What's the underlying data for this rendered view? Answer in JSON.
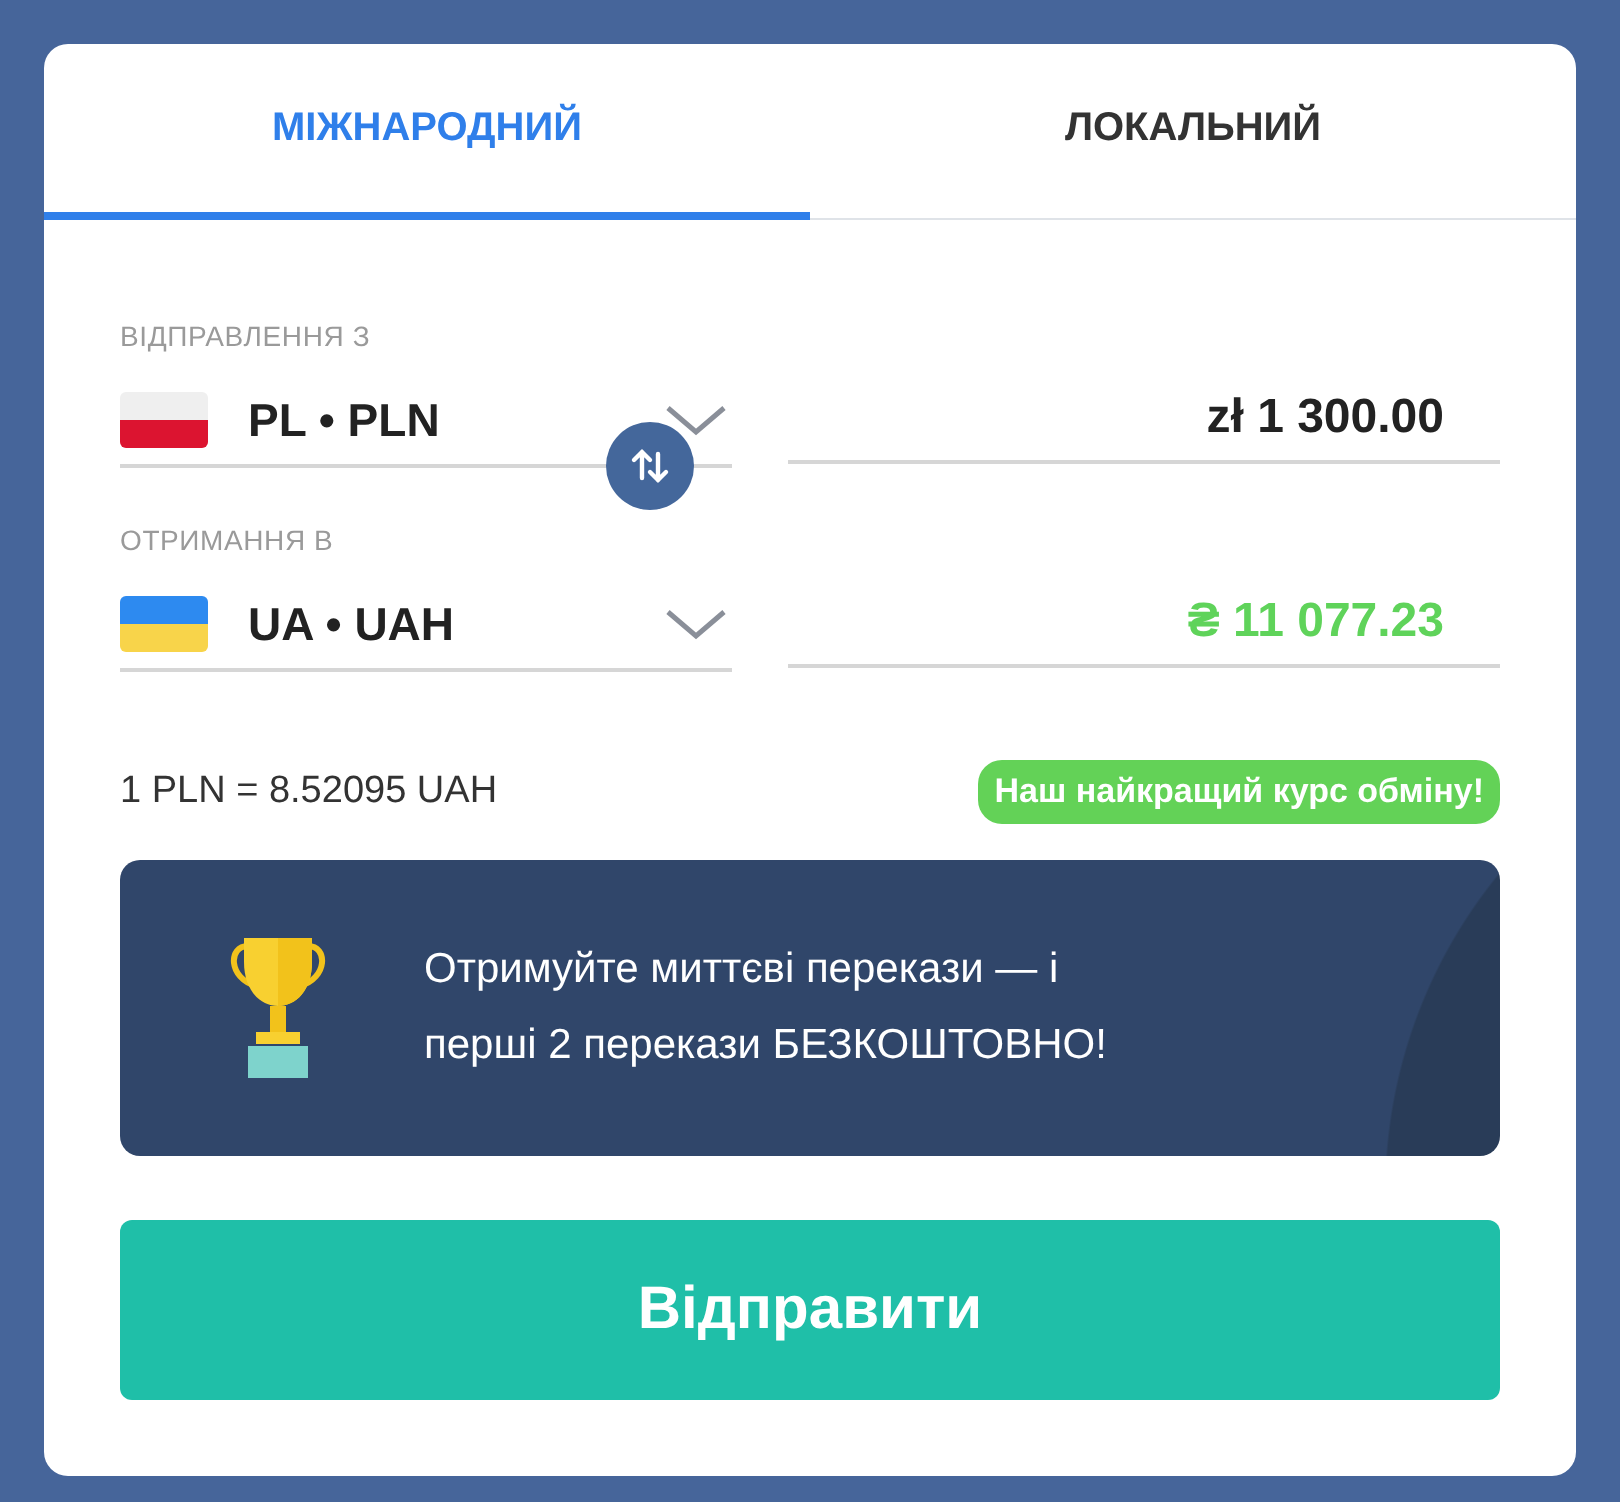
{
  "tabs": [
    {
      "label": "МІЖНАРОДНИЙ",
      "selected": true
    },
    {
      "label": "ЛОКАЛЬНИЙ",
      "selected": false
    }
  ],
  "rows": [
    {
      "label": "ВІДПРАВЛЕННЯ З",
      "kind": "pl",
      "currency": "PL • PLN",
      "amount": "zł 1 300.00",
      "color": "#222222"
    },
    {
      "label": "ОТРИМАННЯ В",
      "kind": "ua",
      "currency": "UA • UAH",
      "amount": "₴ 11 077.23",
      "color": "#5fd35a"
    }
  ],
  "rate": "1 PLN = 8.52095 UAH",
  "rate_badge": "Наш найкращий курс обміну!",
  "promo": "Отримуйте миттєві перекази — і\nперші 2 перекази БЕЗКОШТОВНО!",
  "submit": "Відправити"
}
